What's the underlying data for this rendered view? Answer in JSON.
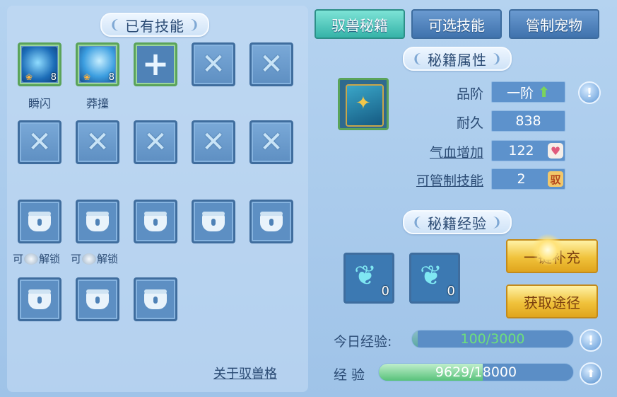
{
  "left": {
    "title": "已有技能",
    "skills": [
      {
        "name": "瞬闪",
        "level": "8"
      },
      {
        "name": "莽撞",
        "level": "8"
      }
    ],
    "unlock_prefix": "可",
    "unlock_suffix": "解锁",
    "about_link": "关于驭兽格"
  },
  "tabs": [
    {
      "label": "驭兽秘籍",
      "active": true
    },
    {
      "label": "可选技能",
      "active": false
    },
    {
      "label": "管制宠物",
      "active": false
    }
  ],
  "attributes": {
    "title": "秘籍属性",
    "grade_label": "品阶",
    "grade_value": "一阶",
    "durability_label": "耐久",
    "durability_value": "838",
    "hp_label": "气血增加",
    "hp_value": "122",
    "control_label": "可管制技能",
    "control_value": "2",
    "control_badge": "驭"
  },
  "experience": {
    "title": "秘籍经验",
    "items": [
      {
        "count": "0"
      },
      {
        "count": "0"
      }
    ],
    "fill_button": "一键补充",
    "source_button": "获取途径",
    "today_label": "今日经验:",
    "today_value": "100/3000",
    "today_fraction": 0.033,
    "exp_label": "经 验",
    "exp_value": "9629/18000",
    "exp_fraction": 0.535
  }
}
